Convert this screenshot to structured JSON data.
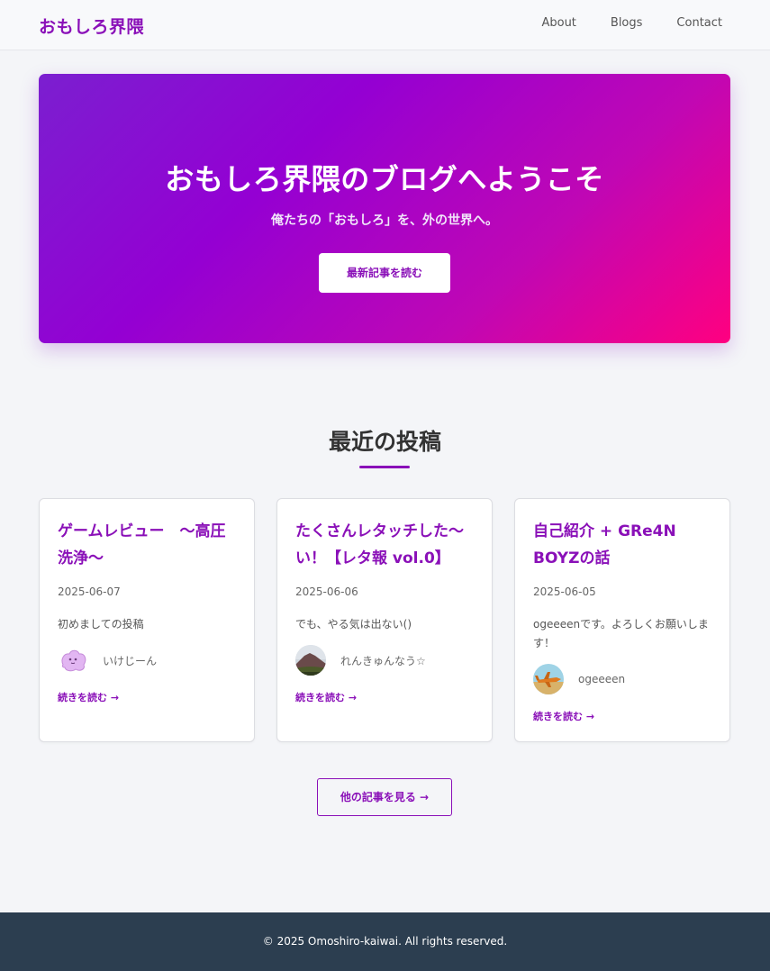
{
  "header": {
    "logo": "おもしろ界隈",
    "nav": [
      "About",
      "Blogs",
      "Contact"
    ]
  },
  "hero": {
    "title": "おもしろ界隈のブログへようこそ",
    "subtitle": "俺たちの「おもしろ」を、外の世界へ。",
    "button": "最新記事を読む"
  },
  "recent": {
    "title": "最近の投稿",
    "posts": [
      {
        "title": "ゲームレビュー　～高圧洗浄～",
        "date": "2025-06-07",
        "excerpt": "初めましての投稿",
        "author": "いけじーん",
        "avatar_icon": "purple-blob-avatar",
        "read_more": "続きを読む →"
      },
      {
        "title": "たくさんレタッチした～い！【レタ報 vol.0】",
        "date": "2025-06-06",
        "excerpt": "でも、やる気は出ない()",
        "author": "れんきゅんなう☆",
        "avatar_icon": "mountain-photo-avatar",
        "read_more": "続きを読む →"
      },
      {
        "title": "自己紹介 + GRe4N BOYZの話",
        "date": "2025-06-05",
        "excerpt": "ogeeeenです。よろしくお願いします！",
        "author": "ogeeeen",
        "avatar_icon": "airplane-photo-avatar",
        "read_more": "続きを読む →"
      }
    ],
    "more_button": "他の記事を見る →"
  },
  "footer": {
    "copyright": "© 2025 Omoshiro-kaiwai. All rights reserved."
  },
  "colors": {
    "accent": "#8a10b8",
    "hero_gradient_start": "#7b1fd0",
    "hero_gradient_end": "#ff0080",
    "footer_bg": "#2c3e50"
  }
}
